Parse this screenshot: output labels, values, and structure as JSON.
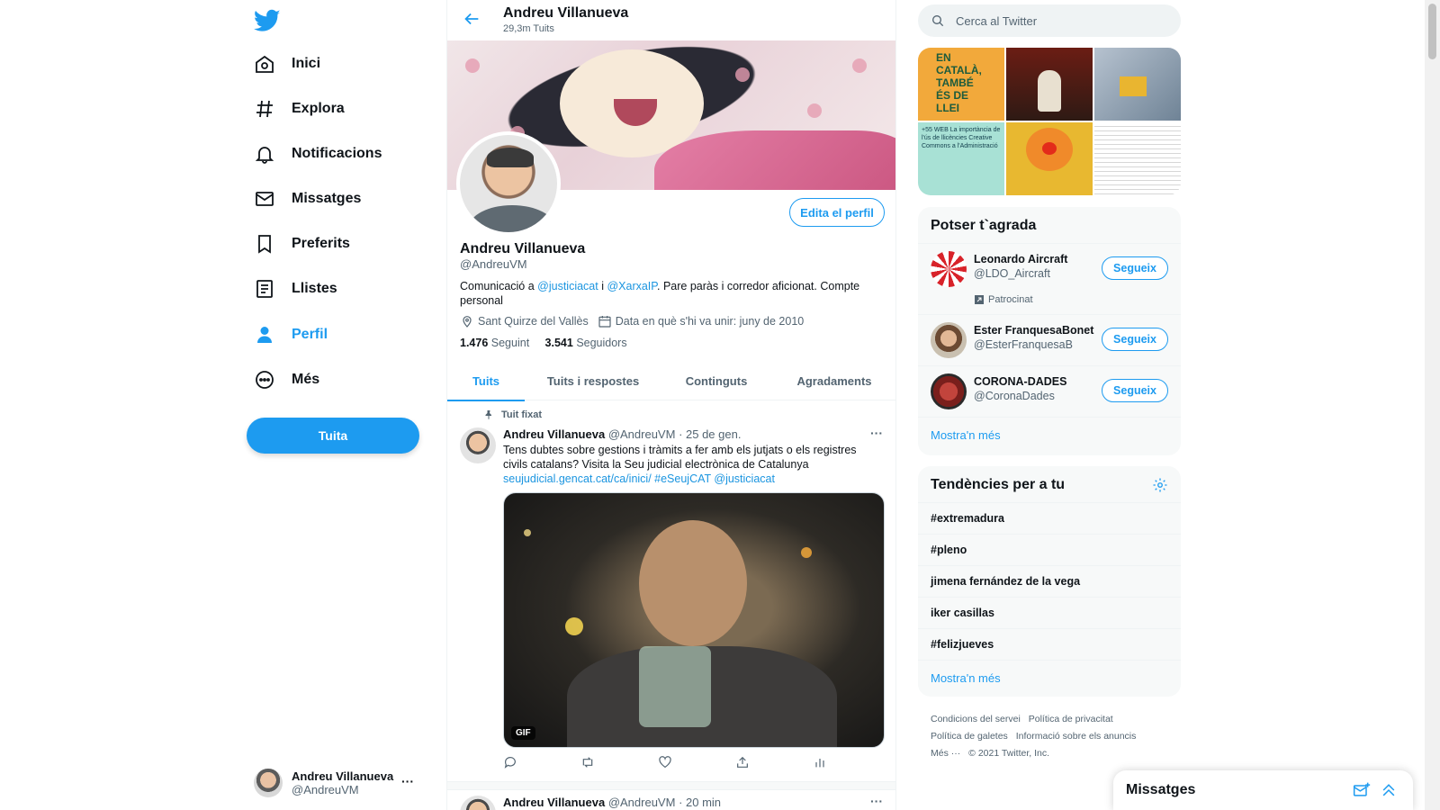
{
  "nav": {
    "items": [
      {
        "label": "Inici",
        "icon": "home-icon"
      },
      {
        "label": "Explora",
        "icon": "hash-icon"
      },
      {
        "label": "Notificacions",
        "icon": "bell-icon"
      },
      {
        "label": "Missatges",
        "icon": "mail-icon"
      },
      {
        "label": "Preferits",
        "icon": "bookmark-icon"
      },
      {
        "label": "Llistes",
        "icon": "list-icon"
      },
      {
        "label": "Perfil",
        "icon": "person-icon"
      },
      {
        "label": "Més",
        "icon": "more-circle-icon"
      }
    ],
    "tweet_button": "Tuita",
    "account": {
      "name": "Andreu Villanueva",
      "handle": "@AndreuVM",
      "menu": "···"
    }
  },
  "header": {
    "name": "Andreu Villanueva",
    "tweet_count": "29,3m Tuits"
  },
  "profile": {
    "edit_button": "Edita el perfil",
    "name": "Andreu Villanueva",
    "handle": "@AndreuVM",
    "bio_prefix": "Comunicació a ",
    "bio_link1": "@justiciacat",
    "bio_mid": " i ",
    "bio_link2": "@XarxaIP",
    "bio_suffix": ". Pare paràs i corredor aficionat. Compte personal",
    "location": "Sant Quirze del Vallès",
    "joined": "Data en què s'hi va unir: juny de 2010",
    "following_count": "1.476",
    "following_label": "Seguint",
    "followers_count": "3.541",
    "followers_label": "Seguidors"
  },
  "tabs": [
    "Tuits",
    "Tuits i respostes",
    "Continguts",
    "Agradaments"
  ],
  "tweets": [
    {
      "pinned_label": "Tuit fixat",
      "name": "Andreu Villanueva",
      "handle": "@AndreuVM",
      "time": "· 25 de gen.",
      "text": "Tens dubtes sobre gestions i tràmits a fer amb els jutjats o els registres civils catalans? Visita la Seu judicial electrònica de Catalunya",
      "links": "seujudicial.gencat.cat/ca/inici/ #eSeujCAT @justiciacat",
      "media_badge": "GIF",
      "menu": "···"
    },
    {
      "name": "Andreu Villanueva",
      "handle": "@AndreuVM",
      "time": "· 20 min",
      "menu": "···"
    }
  ],
  "right": {
    "search_placeholder": "Cerca al Twitter",
    "media_texts": {
      "tile1": "EN CATALÀ, TAMBÉ ÉS DE LLEI",
      "tile4": "+55 WEB La importància de l'ús de llicències Creative Commons a l'Administració"
    },
    "who_title": "Potser t`agrada",
    "who": [
      {
        "name": "Leonardo Aircraft",
        "handle": "@LDO_Aircraft",
        "promoted": "Patrocinat",
        "button": "Segueix"
      },
      {
        "name": "Ester FranquesaBonet",
        "handle": "@EsterFranquesaB",
        "button": "Segueix"
      },
      {
        "name": "CORONA-DADES",
        "handle": "@CoronaDades",
        "button": "Segueix"
      }
    ],
    "who_more": "Mostra'n més",
    "trends_title": "Tendències per a tu",
    "trends": [
      "#extremadura",
      "#pleno",
      "jimena fernández de la vega",
      "iker casillas",
      "#felizjueves"
    ],
    "trends_more": "Mostra'n més",
    "footer": [
      "Condicions del servei",
      "Política de privacitat",
      "Política de galetes",
      "Informació sobre els anuncis",
      "Més ···",
      "© 2021 Twitter, Inc."
    ]
  },
  "messages_drawer": {
    "title": "Missatges"
  },
  "colors": {
    "accent": "#1d9bf0",
    "text": "#0f1419",
    "muted": "#536471"
  }
}
